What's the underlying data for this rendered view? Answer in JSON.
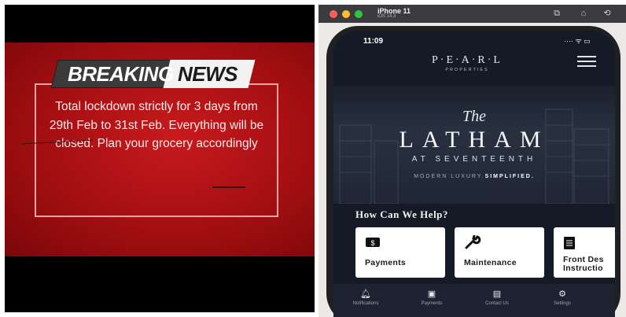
{
  "news": {
    "banner_left": "BREAKING",
    "banner_right": "NEWS",
    "message": "Total lockdown strictly for 3 days from 29th Feb to 31st Feb. Everything will be closed. Plan your grocery accordingly"
  },
  "simulator": {
    "device_name": "iPhone 11",
    "os_version": "iOS 14.3"
  },
  "app": {
    "status_time": "11:09",
    "status_icons": "···· ᯤ ▭",
    "logo": "P·E·A·R·L",
    "logo_sub": "PROPERTIES",
    "hero": {
      "the": "The",
      "title": "LATHAM",
      "subtitle": "AT SEVENTEENTH",
      "tagline_plain": "MODERN LUXURY.",
      "tagline_bold": "SIMPLIFIED."
    },
    "help_title": "How Can We Help?",
    "cards": [
      {
        "label": "Payments",
        "icon": "payments-icon"
      },
      {
        "label": "Maintenance",
        "icon": "wrench-icon"
      },
      {
        "label": "Front Des Instructio",
        "icon": "clipboard-icon"
      }
    ],
    "tabs": [
      {
        "label": "Notifications",
        "icon": "bell-icon"
      },
      {
        "label": "Payments",
        "icon": "payments-icon"
      },
      {
        "label": "Contact Us",
        "icon": "chat-icon"
      },
      {
        "label": "Settings",
        "icon": "gear-icon"
      }
    ]
  },
  "colors": {
    "news_red": "#b31215",
    "app_navy": "#141a26",
    "mac_close": "#ff5f57",
    "mac_min": "#febc2e",
    "mac_max": "#28c840"
  }
}
